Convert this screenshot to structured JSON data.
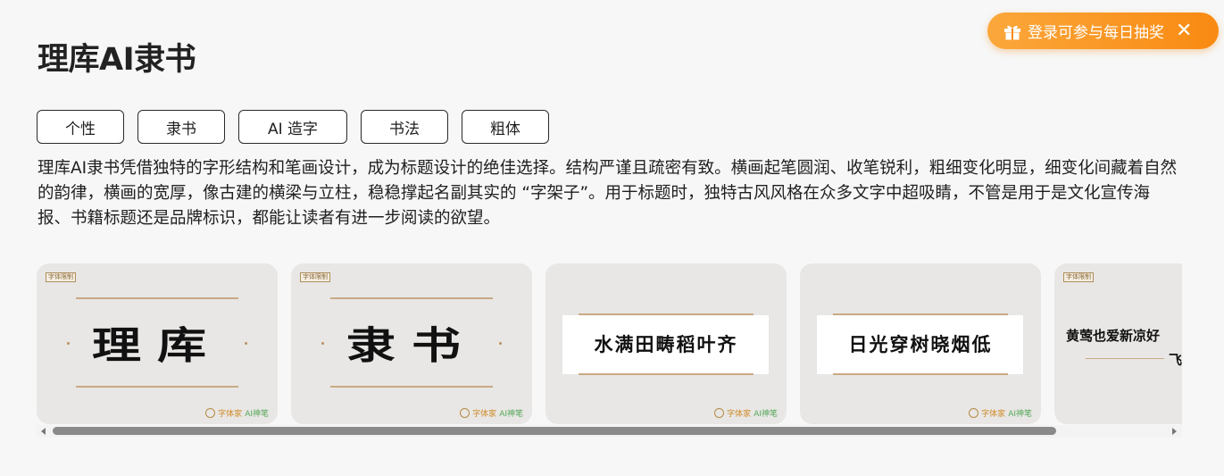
{
  "page": {
    "title": "理库AI隶书",
    "description": "理库AI隶书凭借独特的字形结构和笔画设计，成为标题设计的绝佳选择。结构严谨且疏密有致。横画起笔圆润、收笔锐利，粗细变化明显，细变化间藏着自然的韵律，横画的宽厚，像古建的横梁与立柱，稳稳撑起名副其实的 “字架子”。用于标题时，独特古风风格在众多文字中超吸睛，不管是用于是文化宣传海报、书籍标题还是品牌标识，都能让读者有进一步阅读的欲望。"
  },
  "tags": [
    "个性",
    "隶书",
    "AI 造字",
    "书法",
    "粗体"
  ],
  "promo": {
    "text": "登录可参与每日抽奖",
    "close": "✕",
    "icon": "gift-icon"
  },
  "gallery": {
    "badge": "字体限制",
    "watermark_brand": "字体家",
    "watermark_ai": "AI神笔",
    "cards": [
      {
        "text": "理库"
      },
      {
        "text": "隶书"
      },
      {
        "text": "水满田畴稻叶齐"
      },
      {
        "text": "日光穿树晓烟低"
      },
      {
        "text_line1": "黄莺也爱新凉好",
        "text_line2": "飞"
      }
    ]
  },
  "colors": {
    "accent_orange": "#f98a12",
    "card_bg": "#e8e7e5",
    "rule_gold": "#c9a985"
  }
}
